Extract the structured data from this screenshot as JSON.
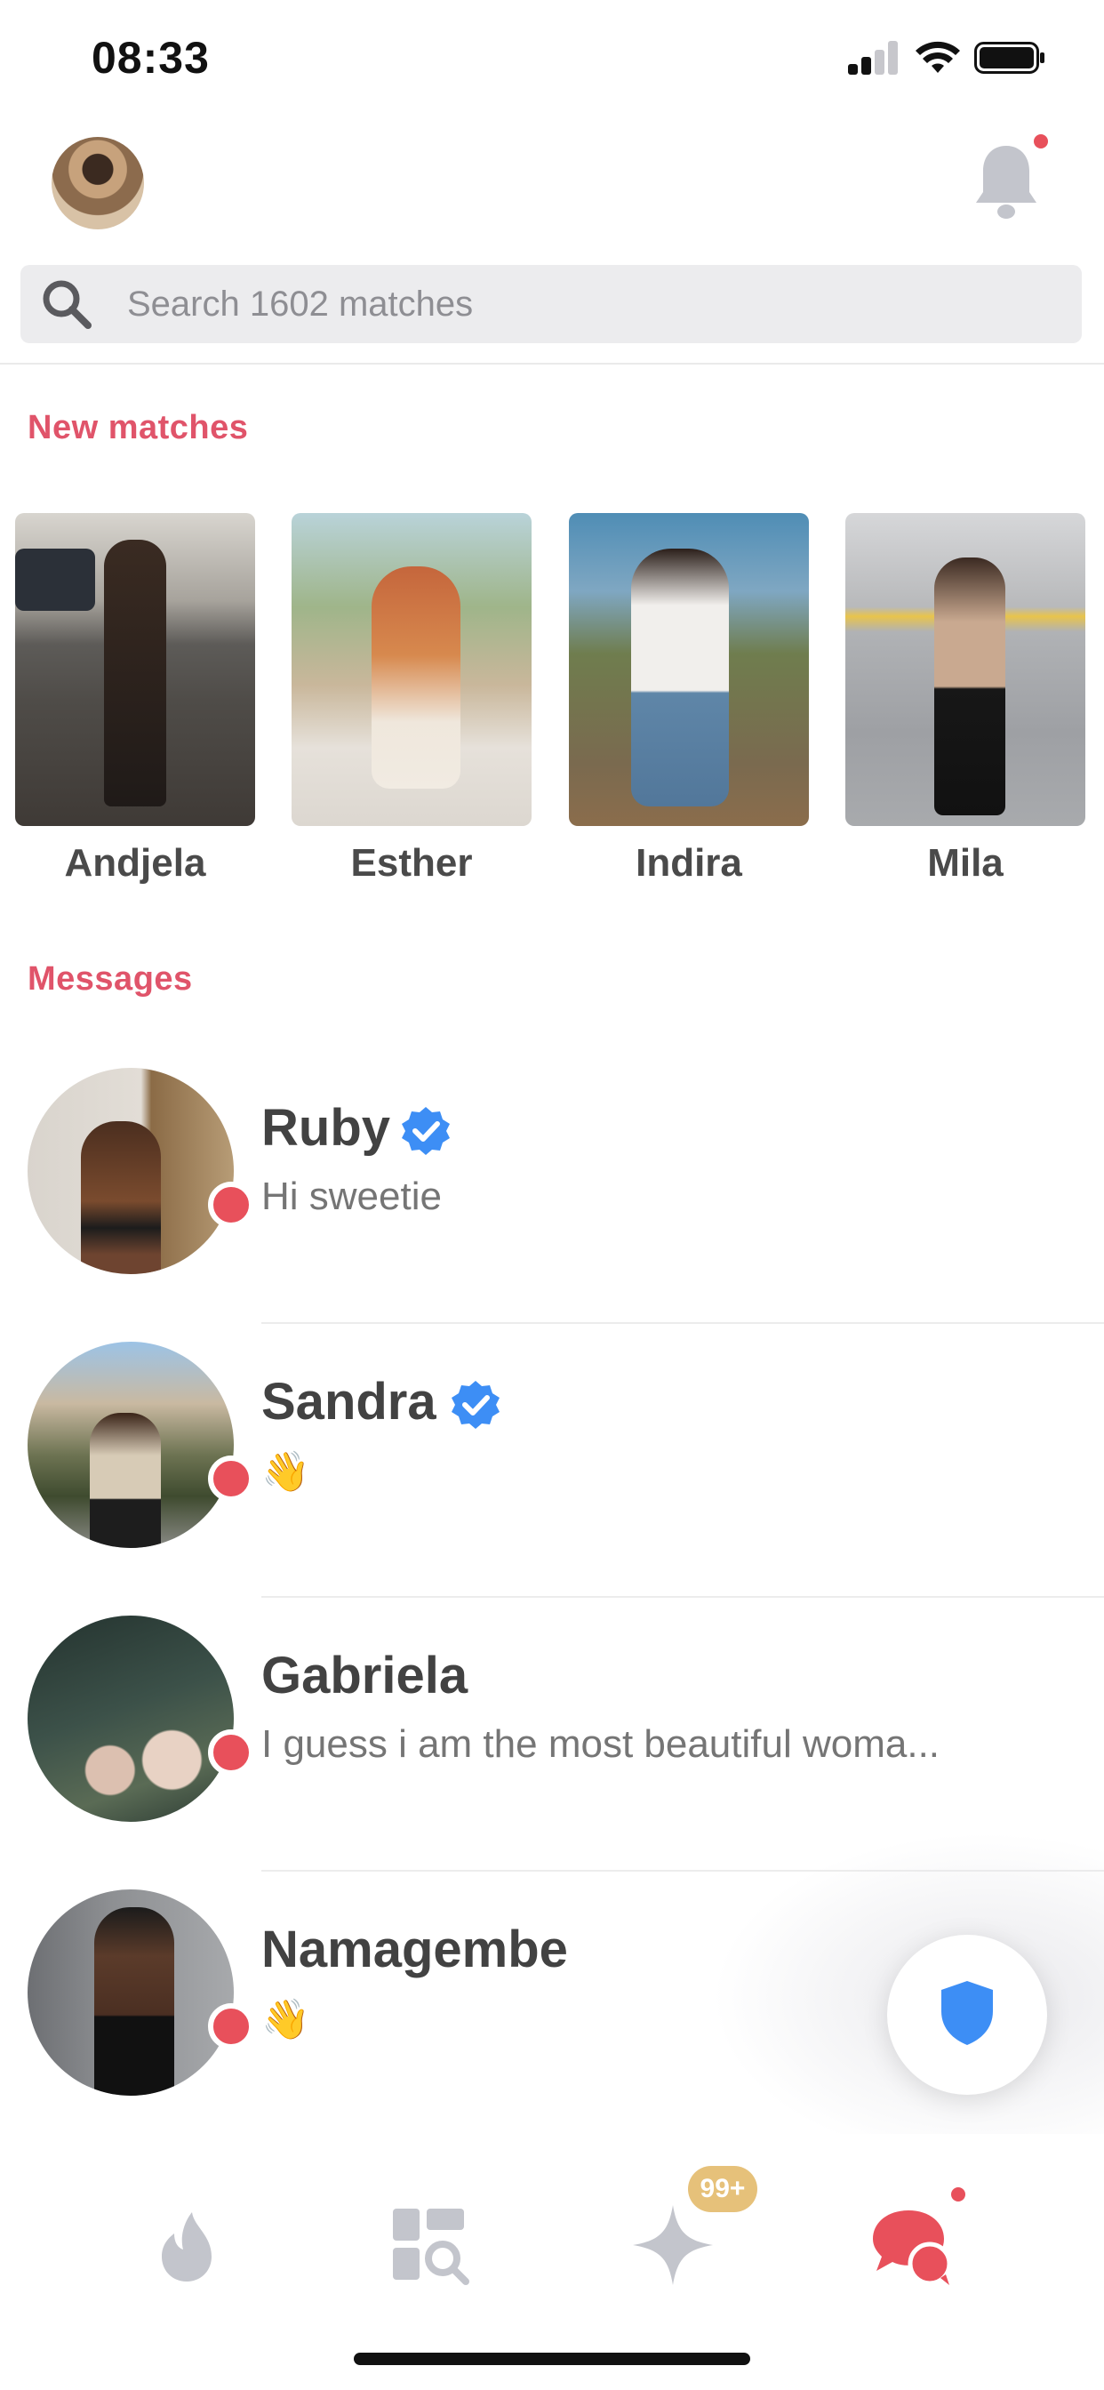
{
  "status_bar": {
    "time": "08:33"
  },
  "search": {
    "placeholder": "Search 1602 matches"
  },
  "new_matches": {
    "title": "New matches",
    "items": [
      {
        "name": "Andjela"
      },
      {
        "name": "Esther"
      },
      {
        "name": "Indira"
      },
      {
        "name": "Mila"
      }
    ]
  },
  "messages": {
    "title": "Messages",
    "items": [
      {
        "name": "Ruby",
        "verified": true,
        "preview": "Hi sweetie"
      },
      {
        "name": "Sandra",
        "verified": true,
        "preview": "👋"
      },
      {
        "name": "Gabriela",
        "verified": false,
        "preview": "I guess i am the most beautiful woma..."
      },
      {
        "name": "Namagembe",
        "verified": false,
        "preview": "👋"
      }
    ]
  },
  "tabbar": {
    "tabs": [
      "flame-icon",
      "explore-icon",
      "gold-sparkle-icon",
      "chat-icon"
    ],
    "badge": "99+"
  },
  "colors": {
    "accent": "#e8505b",
    "heading": "#e0546a",
    "verified": "#3d8ef5",
    "badge": "#e6c17a"
  }
}
